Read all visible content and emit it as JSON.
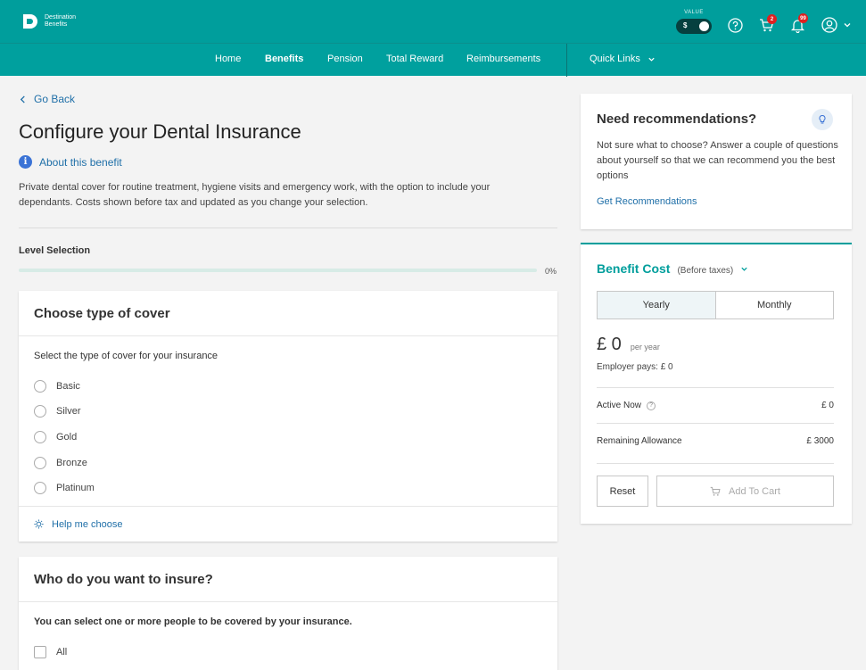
{
  "header": {
    "logo_line1": "Destination",
    "logo_line2": "Benefits",
    "value_label": "VALUE",
    "currency_symbol": "$",
    "cart_count": "2",
    "notifications_count": "99"
  },
  "nav": {
    "items": [
      "Home",
      "Benefits",
      "Pension",
      "Total Reward",
      "Reimbursements"
    ],
    "active": "Benefits",
    "quick_links": "Quick Links"
  },
  "main": {
    "back_label": "Go Back",
    "title": "Configure your Dental Insurance",
    "about_label": "About this benefit",
    "description": "Private dental cover for routine treatment, hygiene visits and emergency work, with the option to include your dependants. Costs shown before tax and updated as you change your selection.",
    "level_selection_label": "Level Selection",
    "progress_percent": 0,
    "progress_label": "0%"
  },
  "cover_card": {
    "title": "Choose type of cover",
    "subtitle": "Select the type of cover for your insurance",
    "options": [
      "Basic",
      "Silver",
      "Gold",
      "Bronze",
      "Platinum"
    ],
    "help_label": "Help me choose"
  },
  "insure_card": {
    "title": "Who do you want to insure?",
    "subtitle": "You can select one or more people to be covered by your insurance.",
    "options": [
      "All"
    ]
  },
  "recommendations": {
    "title": "Need recommendations?",
    "text": "Not sure what to choose? Answer a couple of questions about yourself so that we can recommend you the best options",
    "link": "Get Recommendations"
  },
  "benefit_cost": {
    "title": "Benefit Cost",
    "subtitle": "(Before taxes)",
    "period_options": [
      "Yearly",
      "Monthly"
    ],
    "selected_period": "Yearly",
    "amount": "£ 0",
    "amount_suffix": "per year",
    "employer_pays": "Employer pays:  £ 0",
    "rows": [
      {
        "label": "Active Now",
        "value": "£ 0"
      },
      {
        "label": "Remaining Allowance",
        "value": "£ 3000"
      }
    ],
    "reset_label": "Reset",
    "add_to_cart_label": "Add To Cart"
  },
  "colors": {
    "brand": "#009e9c",
    "link": "#1f6fa8",
    "badge": "#e02020"
  }
}
